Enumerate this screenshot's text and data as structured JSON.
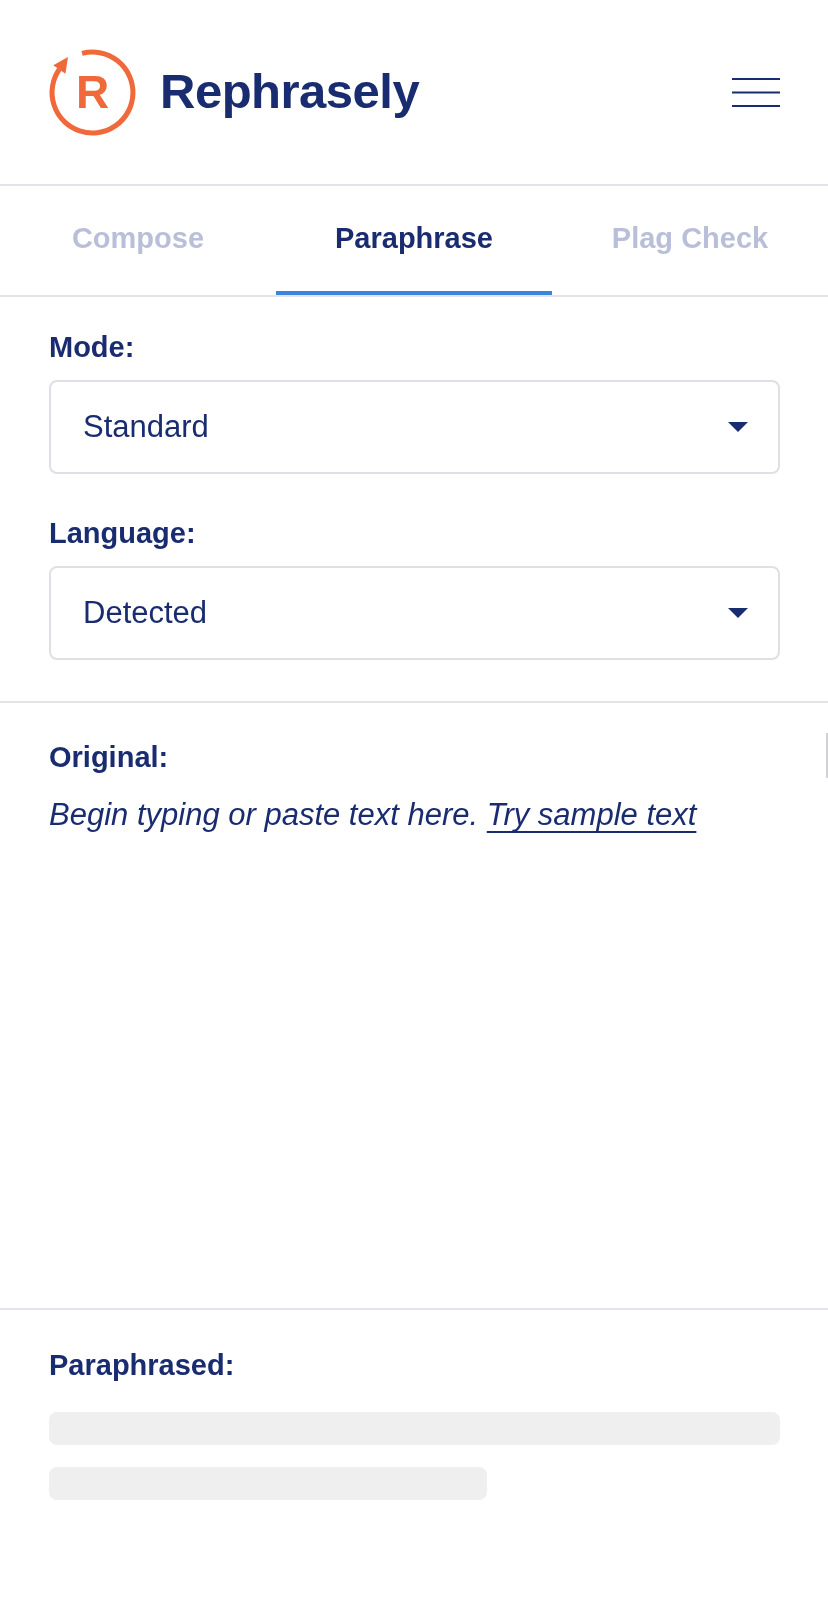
{
  "header": {
    "logo_letter": "R",
    "brand": "Rephrasely"
  },
  "tabs": [
    {
      "label": "Compose",
      "selected": false
    },
    {
      "label": "Paraphrase",
      "selected": true
    },
    {
      "label": "Plag Check",
      "selected": false
    }
  ],
  "settings": [
    {
      "label": "Mode:",
      "value": "Standard"
    },
    {
      "label": "Language:",
      "value": "Detected"
    }
  ],
  "original": {
    "label": "Original:",
    "placeholder": "Begin typing or paste text here.",
    "sample_link": "Try sample text"
  },
  "paraphrased": {
    "label": "Paraphrased:",
    "loading": true
  }
}
